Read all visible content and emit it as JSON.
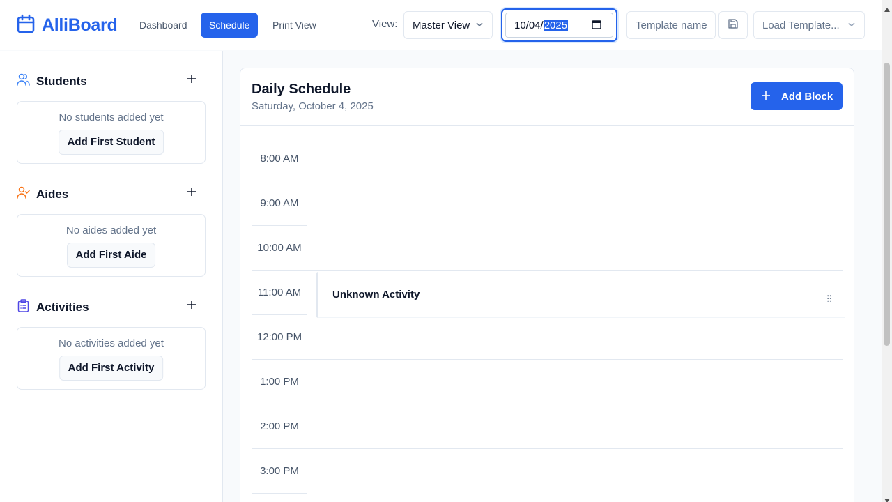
{
  "app": {
    "name": "AlliBoard"
  },
  "nav": {
    "dashboard": "Dashboard",
    "schedule": "Schedule",
    "print_view": "Print View"
  },
  "toolbar": {
    "view_label": "View:",
    "view_value": "Master View",
    "date": {
      "month": "10",
      "day": "04",
      "year": "2025"
    },
    "template_placeholder": "Template name",
    "load_template": "Load Template..."
  },
  "sidebar": {
    "students": {
      "title": "Students",
      "empty": "No students added yet",
      "button": "Add First Student"
    },
    "aides": {
      "title": "Aides",
      "empty": "No aides added yet",
      "button": "Add First Aide"
    },
    "activities": {
      "title": "Activities",
      "empty": "No activities added yet",
      "button": "Add First Activity"
    }
  },
  "schedule": {
    "title": "Daily Schedule",
    "date_text": "Saturday, October 4, 2025",
    "add_block": "Add Block",
    "times": [
      "8:00 AM",
      "9:00 AM",
      "10:00 AM",
      "11:00 AM",
      "12:00 PM",
      "1:00 PM",
      "2:00 PM",
      "3:00 PM"
    ],
    "block": {
      "name": "Unknown Activity"
    }
  },
  "colors": {
    "primary": "#2563eb",
    "students_icon": "#3b82f6",
    "aides_icon": "#f97316",
    "activities_icon": "#4f46e5"
  }
}
